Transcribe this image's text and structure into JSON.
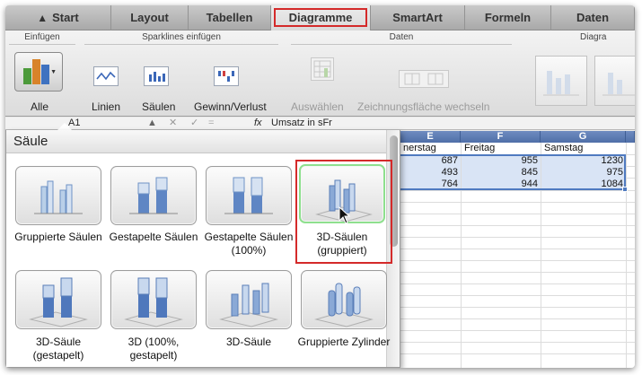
{
  "ribbon_tabs": [
    {
      "label": "Start",
      "icon": "home-icon"
    },
    {
      "label": "Layout"
    },
    {
      "label": "Tabellen"
    },
    {
      "label": "Diagramme",
      "active": true,
      "highlighted": true
    },
    {
      "label": "SmartArt"
    },
    {
      "label": "Formeln"
    },
    {
      "label": "Daten"
    }
  ],
  "ribbon": {
    "group_einfuegen": "Einfügen",
    "group_sparklines": "Sparklines einfügen",
    "group_daten": "Daten",
    "group_diagramm_partial": "Diagra",
    "alle_label": "Alle",
    "linien_label": "Linien",
    "saeulen_label": "Säulen",
    "gewinn_label": "Gewinn/Verlust",
    "auswaehlen_label": "Auswählen",
    "zeichnung_label": "Zeichnungsfläche wechseln"
  },
  "formula_bar": {
    "cell_ref": "A1",
    "fx": "fx",
    "content": "Umsatz in sFr"
  },
  "sheet": {
    "columns": [
      "E",
      "F",
      "G"
    ],
    "headers": [
      "nerstag",
      "Freitag",
      "Samstag"
    ],
    "rows": [
      [
        "687",
        "955",
        "1230"
      ],
      [
        "493",
        "845",
        "975"
      ],
      [
        "764",
        "944",
        "1084"
      ]
    ]
  },
  "gallery": {
    "title": "Säule",
    "items": [
      {
        "label": "Gruppierte Säulen",
        "icon": "clustered-column-icon"
      },
      {
        "label": "Gestapelte Säulen",
        "icon": "stacked-column-icon"
      },
      {
        "label": "Gestapelte Säulen (100%)",
        "icon": "stacked-100-column-icon"
      },
      {
        "label": "3D-Säulen (gruppiert)",
        "icon": "3d-clustered-column-icon",
        "hovered": true,
        "highlighted": true
      },
      {
        "label": "3D-Säule (gestapelt)",
        "icon": "3d-stacked-column-icon"
      },
      {
        "label": "3D (100%, gestapelt)",
        "icon": "3d-100-stacked-column-icon"
      },
      {
        "label": "3D-Säule",
        "icon": "3d-column-icon"
      },
      {
        "label": "Gruppierte Zylinder",
        "icon": "clustered-cylinder-icon"
      }
    ]
  },
  "colors": {
    "highlight_red": "#d42a2a",
    "hover_green": "#8ee08e",
    "header_blue": "#5a78b2",
    "selection_blue": "#d9e4f5"
  }
}
